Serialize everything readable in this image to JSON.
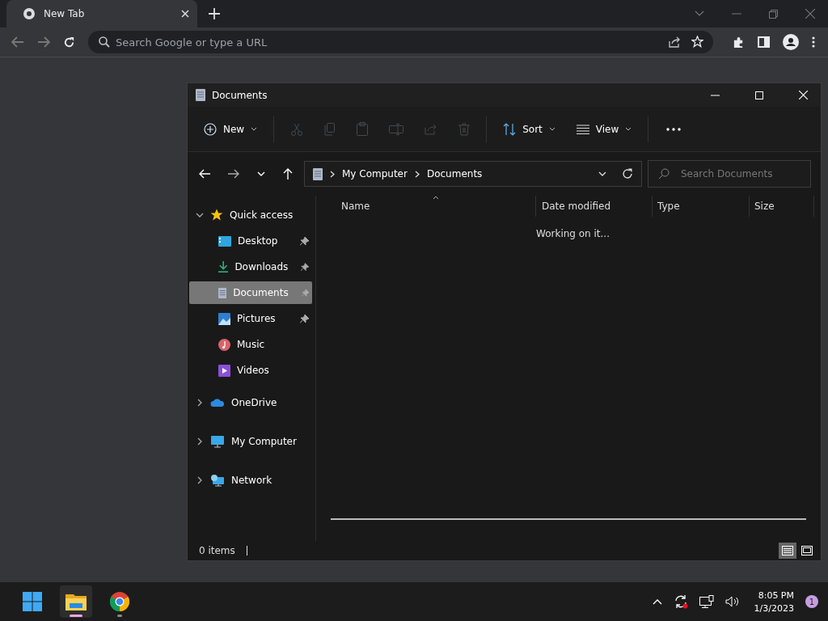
{
  "browser": {
    "tabs": [
      {
        "title": "New Tab",
        "selected": true
      }
    ],
    "omnibox": {
      "placeholder": "Search Google or type a URL"
    }
  },
  "explorer": {
    "title": "Documents",
    "toolbar": [
      {
        "label": "New",
        "disabled": false
      },
      {
        "disabled": true
      },
      {
        "disabled": true
      },
      {
        "disabled": true
      },
      {
        "disabled": true
      },
      {
        "disabled": true
      },
      {
        "disabled": true
      },
      {
        "label": "Sort",
        "disabled": false
      },
      {
        "label": "View",
        "disabled": false
      }
    ],
    "breadcrumb": [
      "My Computer",
      "Documents"
    ],
    "search": {
      "placeholder": "Search Documents"
    },
    "nav": [
      {
        "label": "Quick access",
        "expanded": true,
        "children": [
          {
            "label": "Desktop",
            "pinned": true,
            "selected": false
          },
          {
            "label": "Downloads",
            "pinned": true,
            "selected": false
          },
          {
            "label": "Documents",
            "pinned": true,
            "selected": true
          },
          {
            "label": "Pictures",
            "pinned": true,
            "selected": false
          },
          {
            "label": "Music",
            "pinned": false,
            "selected": false
          },
          {
            "label": "Videos",
            "pinned": false,
            "selected": false
          }
        ]
      },
      {
        "label": "OneDrive",
        "expanded": false
      },
      {
        "label": "My Computer",
        "expanded": false
      },
      {
        "label": "Network",
        "expanded": false
      }
    ],
    "columns": [
      "Name",
      "Date modified",
      "Type",
      "Size"
    ],
    "message": "Working on it...",
    "status": "0 items",
    "views": [
      {
        "selected": true
      },
      {
        "selected": false
      }
    ]
  },
  "taskbar": {
    "apps": [
      {
        "selected": false
      },
      {
        "selected": true
      },
      {
        "selected": false
      }
    ],
    "time": "8:05 PM",
    "date": "1/3/2023",
    "notifications": "1"
  }
}
